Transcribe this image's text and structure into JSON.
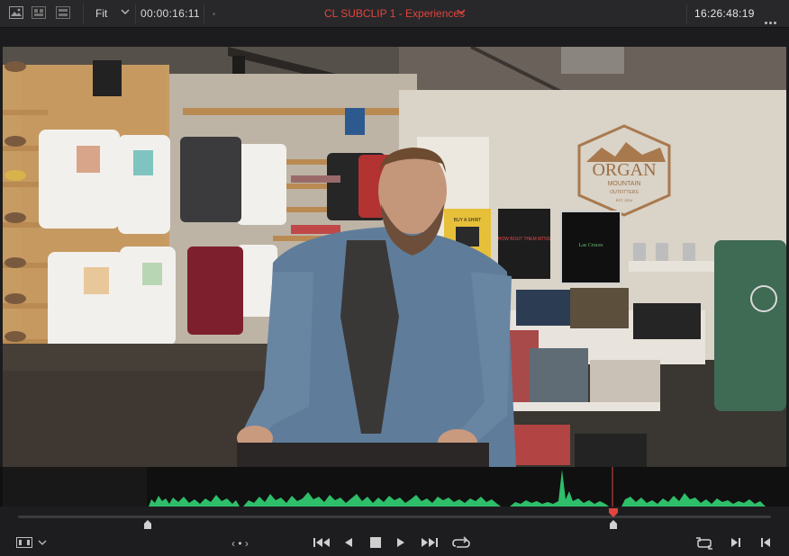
{
  "toolbar": {
    "zoom_label": "Fit",
    "source_timecode": "00:00:16:11",
    "clip_name": "CL SUBCLIP 1 - Experiences",
    "record_timecode": "16:26:48:19",
    "icons": [
      "image-viewer-icon",
      "split-view-icon",
      "clip-view-icon",
      "chevron-down-icon",
      "more-options-icon"
    ]
  },
  "viewer": {
    "signs": {
      "logo_main": "ORGAN",
      "logo_sub": "MOUNTAIN",
      "logo_small": "OUTFITTERS",
      "logo_est": "EST. 2014",
      "poster_1": "BUY A SHIRT",
      "poster_2": "HOW BOUT THEM MTNS",
      "poster_3": "Las Cruces"
    }
  },
  "scrubber": {
    "in_point": 0.172,
    "out_point": 0.785,
    "playhead": 0.785
  },
  "transport": {
    "jog_label": "‹ • ›",
    "buttons": [
      "previous-clip",
      "reverse-play",
      "stop",
      "play",
      "next-clip",
      "loop"
    ]
  },
  "colors": {
    "accent": "#e0443e",
    "waveform": "#2fbe6a",
    "background": "#1c1c1e"
  }
}
